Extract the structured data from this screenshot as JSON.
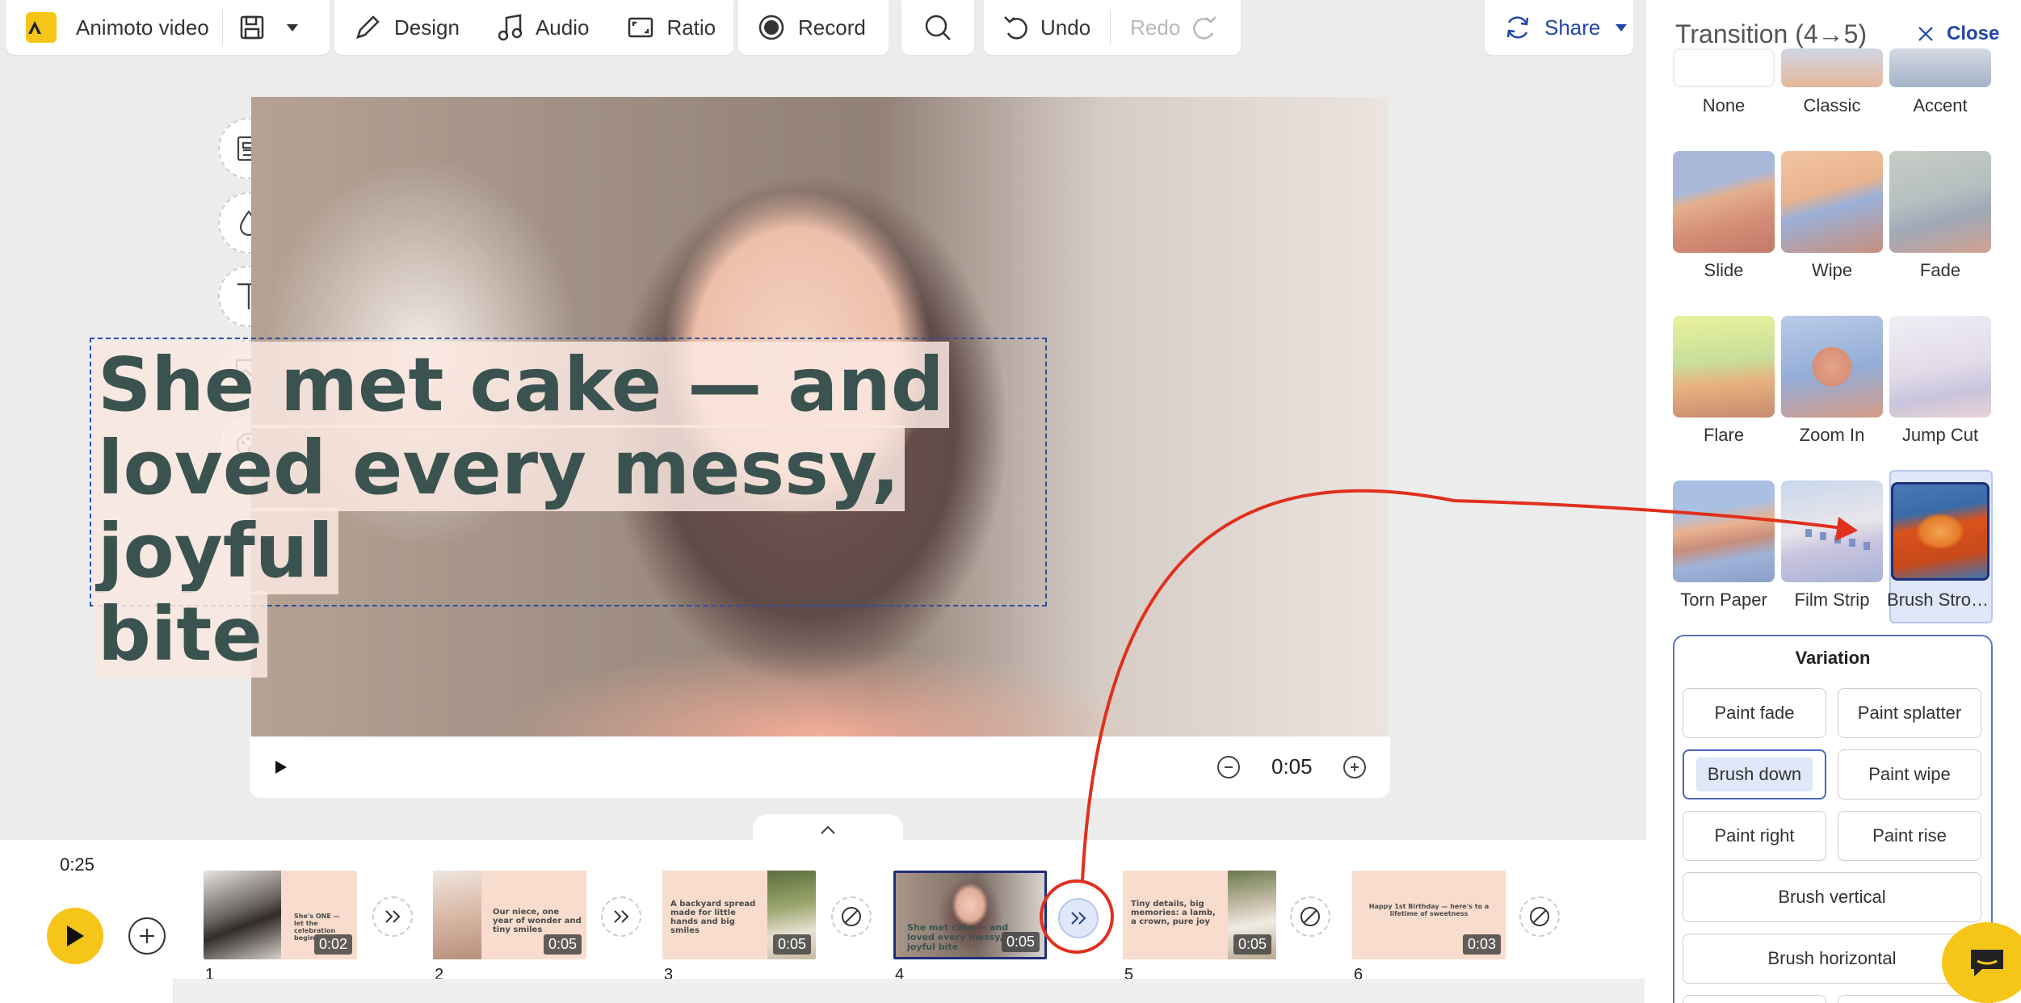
{
  "toolbar": {
    "project_name": "Animoto video",
    "design": "Design",
    "audio": "Audio",
    "ratio": "Ratio",
    "record": "Record",
    "undo": "Undo",
    "redo": "Redo",
    "share": "Share"
  },
  "canvas": {
    "caption_line1": "She met cake — and",
    "caption_line2": "loved every messy, joyful",
    "caption_line3": "bite"
  },
  "player": {
    "duration": "0:05"
  },
  "timeline": {
    "total_time": "0:25",
    "slides": [
      {
        "num": "1",
        "text": "She's ONE — let the celebration begin",
        "duration": "0:02"
      },
      {
        "num": "2",
        "text": "Our niece, one year of wonder and tiny smiles",
        "duration": "0:05"
      },
      {
        "num": "3",
        "text": "A backyard spread made for little hands and big smiles",
        "duration": "0:05"
      },
      {
        "num": "4",
        "text": "She met cake — and loved every messy, joyful bite",
        "duration": "0:05"
      },
      {
        "num": "5",
        "text": "Tiny details, big memories: a lamb, a crown, pure joy",
        "duration": "0:05"
      },
      {
        "num": "6",
        "text": "Happy 1st Birthday — here's to a lifetime of sweetness",
        "duration": "0:03"
      }
    ]
  },
  "panel": {
    "title": "Transition (4→5)",
    "close": "Close",
    "transitions": [
      {
        "label": "None"
      },
      {
        "label": "Classic"
      },
      {
        "label": "Accent"
      },
      {
        "label": "Slide"
      },
      {
        "label": "Wipe"
      },
      {
        "label": "Fade"
      },
      {
        "label": "Flare"
      },
      {
        "label": "Zoom In"
      },
      {
        "label": "Jump Cut"
      },
      {
        "label": "Torn Paper"
      },
      {
        "label": "Film Strip"
      },
      {
        "label": "Brush Stro…"
      }
    ],
    "variation_title": "Variation",
    "variations": [
      "Paint fade",
      "Paint splatter",
      "Brush down",
      "Paint wipe",
      "Paint right",
      "Paint rise",
      "Brush vertical",
      "Brush horizontal"
    ],
    "selected_variation": "Brush down",
    "selected_transition": "Brush Stroke"
  },
  "colors": {
    "accent_yellow": "#f5c518",
    "selection_blue": "#2346a8",
    "annotation_red": "#e0301e"
  }
}
